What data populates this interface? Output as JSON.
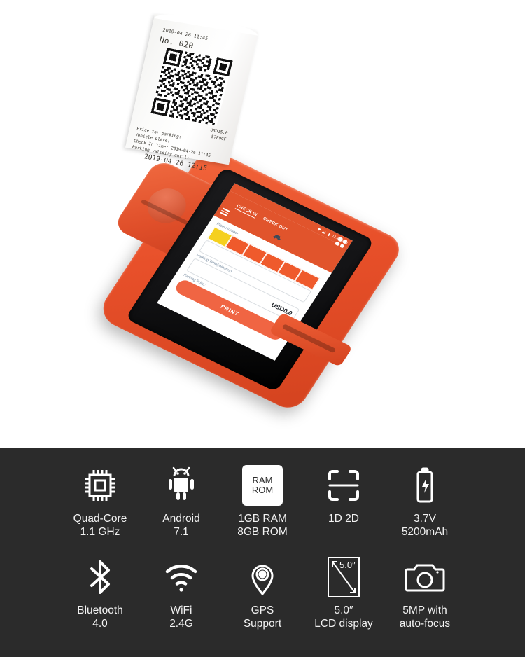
{
  "product": {
    "name": "Handheld Android POS Terminal",
    "body_color": "#e8502a",
    "accent_color": "#f06543",
    "panel_color": "#2b2b2b"
  },
  "receipt": {
    "datetime": "2019-04-26 11:45",
    "number": "No. 020",
    "price_value": "USD15.0",
    "plate_value": "5789GF",
    "lines": [
      "Price for parking:",
      "Vehicle plate:",
      "Check In Time:  2019-04-26 11:45",
      "Parking validity until:"
    ],
    "validity_until": "2019-04-26 12:15",
    "qr_label": "qr-code"
  },
  "device_screen": {
    "status_bar": {
      "time": "11:47 AM",
      "icons": [
        "wifi-icon",
        "signal-icon",
        "battery-icon"
      ]
    },
    "grid_icon": "apps-grid-icon",
    "menu_icon": "hamburger-menu-icon",
    "vehicle_icon": "car-icon",
    "tabs": [
      {
        "label": "CHECK IN",
        "active": true
      },
      {
        "label": "CHECK OUT",
        "active": false
      }
    ],
    "fields": {
      "plate_label": "Plate Number:",
      "plate_cells": 6,
      "plate_first_color": "#f5d01f",
      "plate_cell_color": "#ef5a2c",
      "time_label": "Parking Time(minutes)",
      "time_value": "",
      "price_label": "Parking Price:",
      "price_value": "USD0.0"
    },
    "print_button": "PRINT",
    "nav_buttons": [
      "back-triangle-icon",
      "home-circle-icon",
      "recents-square-icon"
    ]
  },
  "specs": {
    "row1": [
      {
        "icon": "cpu-chip-icon",
        "line1": "Quad-Core",
        "line2": "1.1 GHz"
      },
      {
        "icon": "android-icon",
        "line1": "Android",
        "line2": "7.1"
      },
      {
        "icon": "memory-icon",
        "line1": "1GB RAM",
        "line2": "8GB ROM",
        "badge1": "RAM",
        "badge2": "ROM"
      },
      {
        "icon": "barcode-scan-icon",
        "line1": "1D 2D",
        "line2": ""
      },
      {
        "icon": "battery-icon",
        "line1": "3.7V",
        "line2": "5200mAh"
      }
    ],
    "row2": [
      {
        "icon": "bluetooth-icon",
        "line1": "Bluetooth",
        "line2": "4.0"
      },
      {
        "icon": "wifi-icon",
        "line1": "WiFi",
        "line2": "2.4G"
      },
      {
        "icon": "gps-pin-icon",
        "line1": "GPS",
        "line2": "Support"
      },
      {
        "icon": "lcd-display-icon",
        "line1": "5.0″",
        "line2": "LCD display",
        "badge1": "5.0″"
      },
      {
        "icon": "camera-icon",
        "line1": "5MP with",
        "line2": "auto-focus"
      }
    ]
  }
}
